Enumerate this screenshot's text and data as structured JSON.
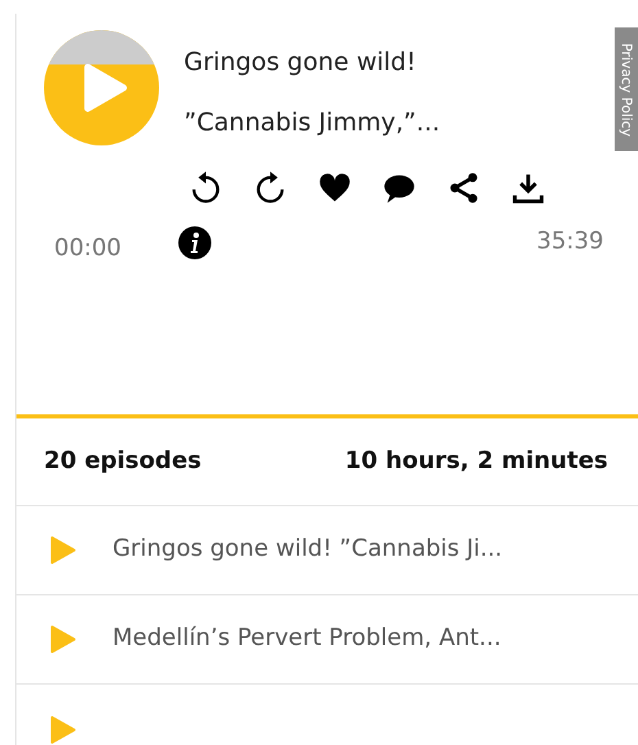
{
  "player": {
    "title_lines": [
      "Gringos gone wild!",
      "”Cannabis Jimmy,”..."
    ],
    "elapsed": "00:00",
    "duration": "35:39"
  },
  "privacy_tab": {
    "label": "Privacy Policy"
  },
  "summary": {
    "episodes": "20 episodes",
    "total_time": "10 hours, 2 minutes"
  },
  "episodes": [
    {
      "title": "Gringos gone wild! ”Cannabis Ji..."
    },
    {
      "title": "Medellín’s Pervert Problem, Ant..."
    }
  ]
}
